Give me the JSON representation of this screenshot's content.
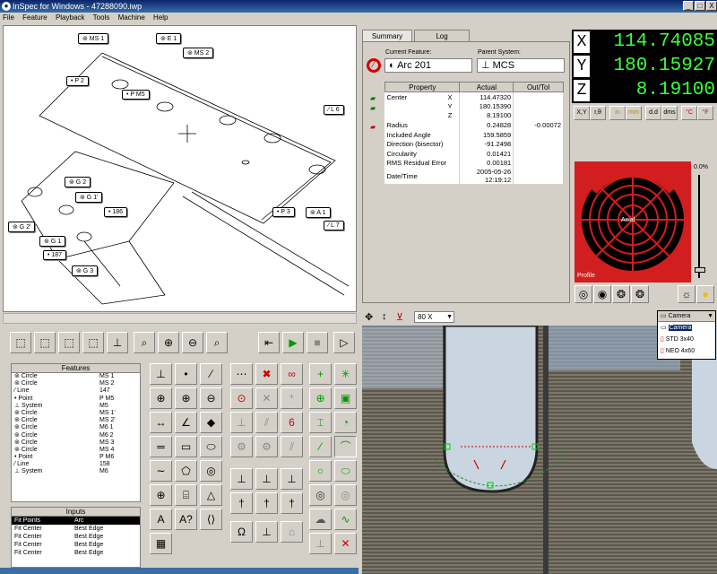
{
  "window": {
    "title": "InSpec for Windows - 47288090.iwp",
    "min": "_",
    "restore": "□",
    "close": "X"
  },
  "menu": [
    "File",
    "Feature",
    "Playback",
    "Tools",
    "Machine",
    "Help"
  ],
  "cad_tags": {
    "ms1": "⊚ MS 1",
    "e1": "⊚ E 1",
    "ms2": "⊚ MS 2",
    "p2": "• P 2",
    "pm5": "• P M5",
    "l6": "⁄ L 6",
    "g2": "⊚ G 2",
    "g1p": "⊚ G 1'",
    "n186": "• 186",
    "g2p": "⊚ G 2'",
    "g1": "⊚ G 1",
    "n187": "• 187",
    "g3": "⊚ G 3",
    "p3": "• P 3",
    "a1": "⊚ A 1",
    "l7": "⁄ L 7"
  },
  "features": {
    "header": "Features",
    "rows": [
      {
        "type": "⊚ Circle",
        "name": "MS 1"
      },
      {
        "type": "⊚ Circle",
        "name": "MS 2"
      },
      {
        "type": "⁄ Line",
        "name": "147"
      },
      {
        "type": "• Point",
        "name": "P M5"
      },
      {
        "type": "⊥ System",
        "name": "M5"
      },
      {
        "type": "⊚ Circle",
        "name": "MS 1'"
      },
      {
        "type": "⊚ Circle",
        "name": "MS 2'"
      },
      {
        "type": "⊚ Circle",
        "name": "M6 1"
      },
      {
        "type": "⊚ Circle",
        "name": "M6 2"
      },
      {
        "type": "⊚ Circle",
        "name": "MS 3"
      },
      {
        "type": "⊚ Circle",
        "name": "MS 4"
      },
      {
        "type": "• Point",
        "name": "P M6"
      },
      {
        "type": "⁄ Line",
        "name": "158"
      },
      {
        "type": "⊥ System",
        "name": "M6"
      }
    ]
  },
  "inputs": {
    "header": "Inputs",
    "rows": [
      {
        "type": "Fit Points",
        "name": "Arc",
        "selected": true
      },
      {
        "type": "Fit Center",
        "name": "Best Edge"
      },
      {
        "type": "Fit Center",
        "name": "Best Edge"
      },
      {
        "type": "Fit Center",
        "name": "Best Edge"
      },
      {
        "type": "Fit Center",
        "name": "Best Edge"
      }
    ]
  },
  "summary": {
    "tabs": [
      "Summary",
      "Log"
    ],
    "current_feature_label": "Current Feature:",
    "current_feature": "Arc 201",
    "parent_system_label": "Parent System:",
    "parent_system": "MCS",
    "columns": [
      "Property",
      "Actual",
      "Out/Tol"
    ],
    "rows": [
      {
        "prop": "Center",
        "axis": "X",
        "actual": "114.47320",
        "tol": ""
      },
      {
        "prop": "",
        "axis": "Y",
        "actual": "180.15390",
        "tol": ""
      },
      {
        "prop": "",
        "axis": "Z",
        "actual": "8.19100",
        "tol": ""
      },
      {
        "prop": "Radius",
        "axis": "",
        "actual": "0.24828",
        "tol": "-0.00072"
      },
      {
        "prop": "Included Angle",
        "axis": "",
        "actual": "159.5859",
        "tol": ""
      },
      {
        "prop": "Direction (bisector)",
        "axis": "",
        "actual": "-91.2498",
        "tol": ""
      },
      {
        "prop": "Circularity",
        "axis": "",
        "actual": "0.01421",
        "tol": ""
      },
      {
        "prop": "RMS Residual Error",
        "axis": "",
        "actual": "0.00181",
        "tol": ""
      },
      {
        "prop": "Date/Time",
        "axis": "",
        "actual": "2005-05-26 12:19:12",
        "tol": ""
      }
    ]
  },
  "dro": [
    {
      "axis": "X",
      "value": "114.74085"
    },
    {
      "axis": "Y",
      "value": "180.15927"
    },
    {
      "axis": "Z",
      "value": "8.19100"
    }
  ],
  "units": [
    "X,Y",
    "r,θ",
    "in",
    "mm",
    "d.d",
    "dms",
    "°C",
    "°F"
  ],
  "lights": {
    "percent": "0.0%",
    "axial": "Axial",
    "profile": "Profile"
  },
  "camera": {
    "zoom": "80 X",
    "selected": "Camera",
    "options": [
      "Camera",
      "STD 3x40",
      "NEO 4x60"
    ]
  },
  "colors": {
    "dro_text": "#3cff3c",
    "light_panel": "#d21e1e",
    "titlebar": "#0a246a"
  }
}
